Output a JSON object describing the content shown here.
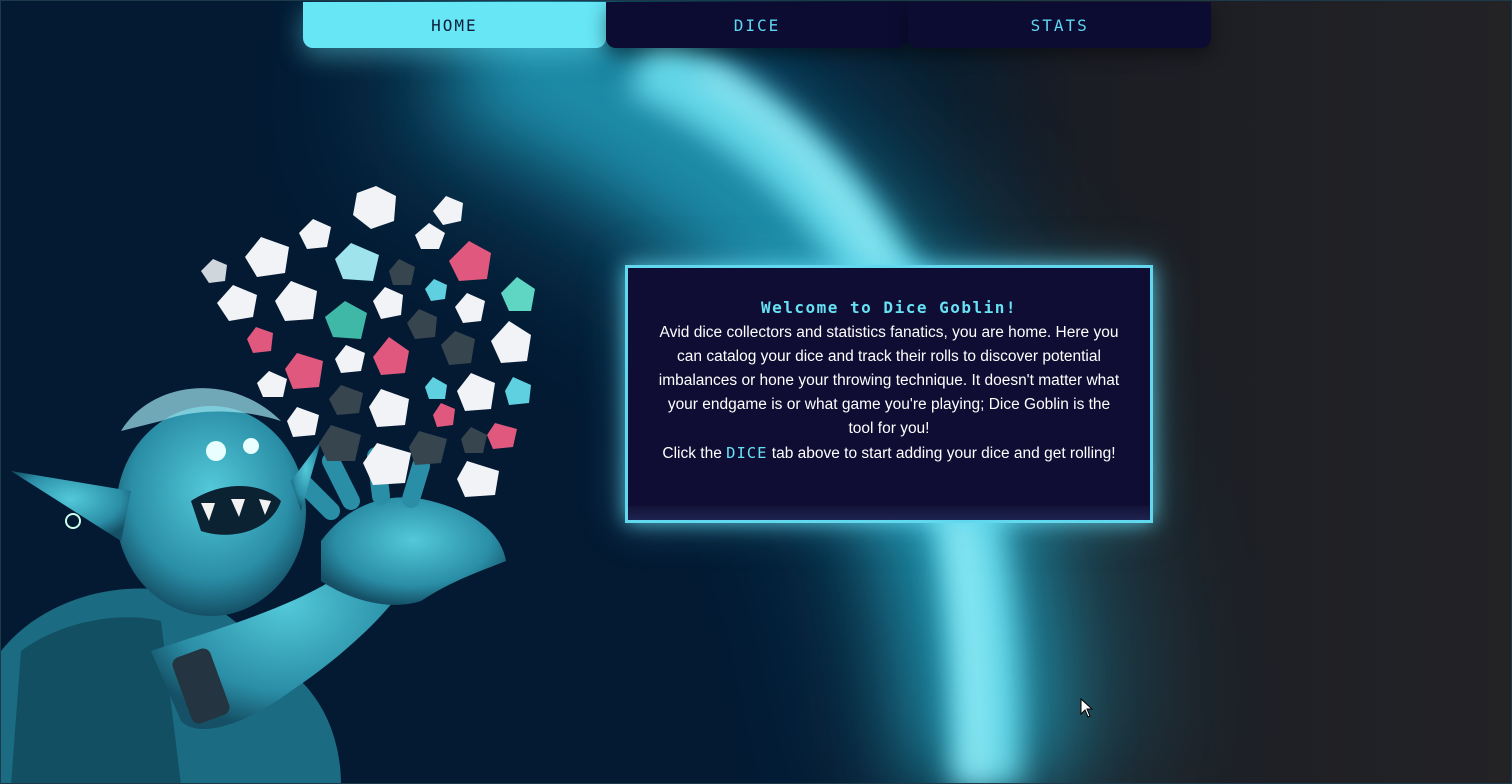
{
  "nav": {
    "tabs": [
      {
        "label": "HOME",
        "active": true
      },
      {
        "label": "DICE",
        "active": false
      },
      {
        "label": "STATS",
        "active": false
      }
    ]
  },
  "welcome": {
    "title": "Welcome to Dice Goblin!",
    "body": "Avid dice collectors and statistics fanatics, you are home. Here you can catalog your dice and track their rolls to discover potential imbalances or hone your throwing technique. It doesn't matter what your endgame is or what game you're playing; Dice Goblin is the tool for you!",
    "cta_before": "Click the",
    "cta_link": "DICE",
    "cta_after": "tab above to start adding your dice and get rolling!"
  },
  "colors": {
    "accent": "#67e6f6",
    "panel_bg": "#0f0d33",
    "page_bg": "#041a33"
  },
  "icons": {
    "illustration": "goblin-juggling-dice-illustration",
    "cursor": "mouse-pointer-icon"
  }
}
